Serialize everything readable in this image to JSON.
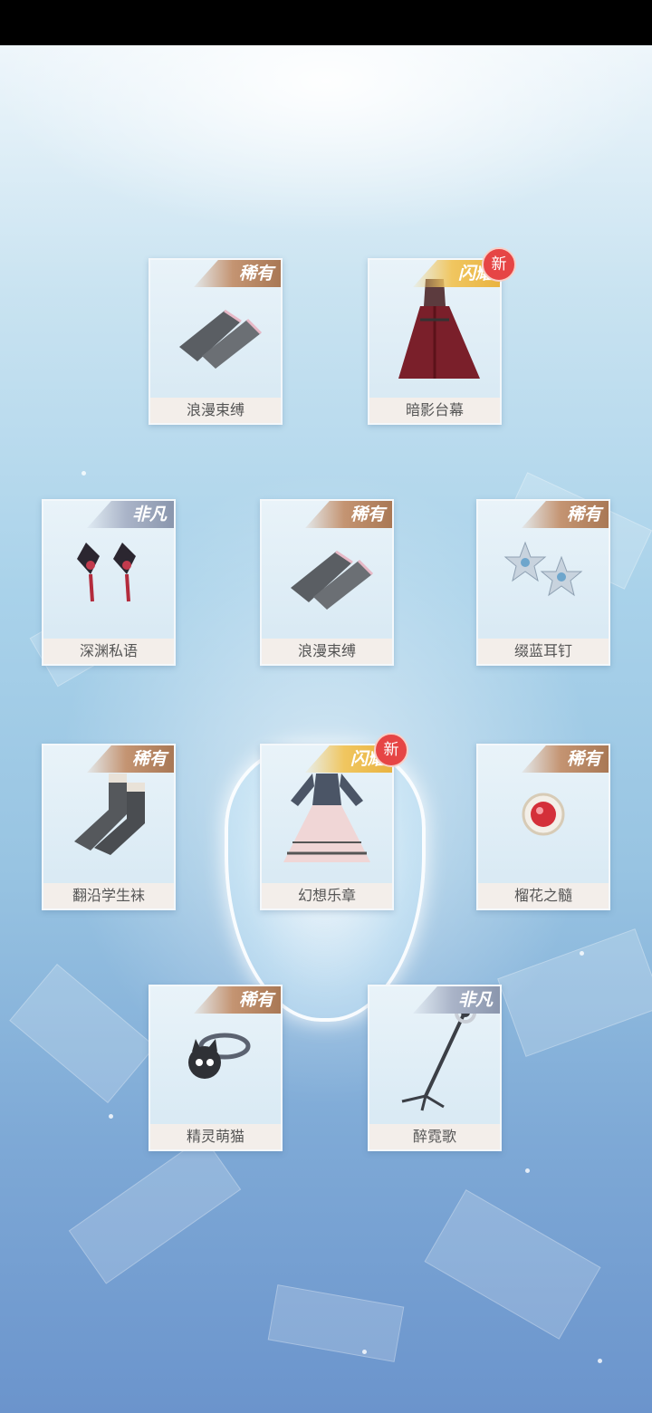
{
  "items": [
    {
      "name": "浪漫束缚",
      "rarity": "稀有",
      "new": false
    },
    {
      "name": "暗影台幕",
      "rarity": "闪耀",
      "new": true,
      "badge": "新"
    },
    {
      "name": "深渊私语",
      "rarity": "非凡",
      "new": false
    },
    {
      "name": "浪漫束缚",
      "rarity": "稀有",
      "new": false
    },
    {
      "name": "缀蓝耳钉",
      "rarity": "稀有",
      "new": false
    },
    {
      "name": "翻沿学生袜",
      "rarity": "稀有",
      "new": false
    },
    {
      "name": "幻想乐章",
      "rarity": "闪耀",
      "new": true,
      "badge": "新"
    },
    {
      "name": "榴花之髓",
      "rarity": "稀有",
      "new": false
    },
    {
      "name": "精灵萌猫",
      "rarity": "稀有",
      "new": false
    },
    {
      "name": "醉霓歌",
      "rarity": "非凡",
      "new": false
    }
  ],
  "colors": {
    "rare_tag": "#c49472",
    "shine_tag": "#f0c660",
    "special_tag": "#aab4c8",
    "new_badge": "#e64545"
  }
}
